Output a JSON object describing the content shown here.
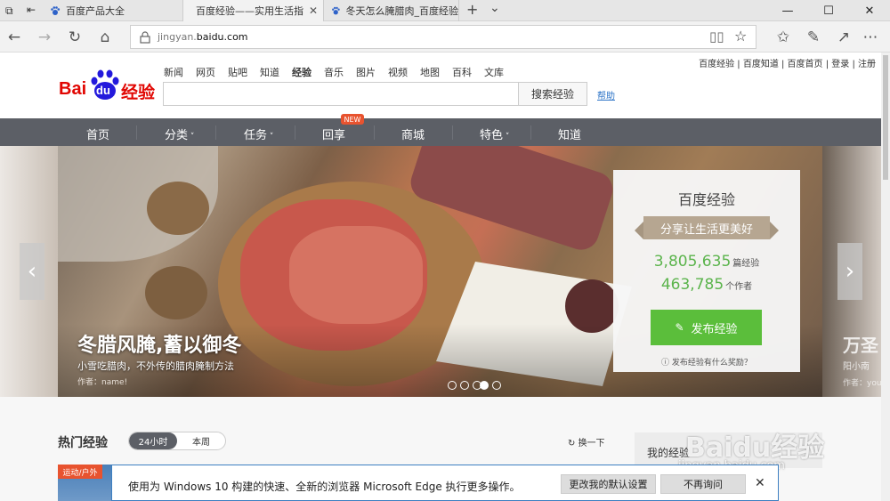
{
  "tabs": [
    {
      "title": "百度产品大全",
      "active": false
    },
    {
      "title": "百度经验——实用生活指",
      "active": true
    },
    {
      "title": "冬天怎么腌腊肉_百度经验",
      "active": false
    }
  ],
  "window_controls": {
    "minimize": "—",
    "maximize": "☐",
    "close": "✕",
    "new_tab": "+",
    "tab_list": "⌄"
  },
  "address": {
    "prefix": "jingyan.",
    "domain": "baidu.com"
  },
  "top_links": "百度经验 | 百度知道 | 百度首页 | 登录 | 注册",
  "logo": {
    "bai": "Bai",
    "du": "du",
    "jingyan": "经验"
  },
  "main_nav": [
    "新闻",
    "网页",
    "贴吧",
    "知道",
    "经验",
    "音乐",
    "图片",
    "视频",
    "地图",
    "百科",
    "文库"
  ],
  "search": {
    "button": "搜索经验",
    "help": "帮助"
  },
  "gray_nav": [
    "首页",
    "分类",
    "任务",
    "回享",
    "商城",
    "特色",
    "知道"
  ],
  "new_badge": "NEW",
  "banner": {
    "title": "冬腊风腌,蓄以御冬",
    "subtitle": "小雪吃腊肉，不外传的腊肉腌制方法",
    "author": "作者：name!",
    "slides_total": 5,
    "slide_active": 4,
    "peek_title": "万圣",
    "peek_sub": "阳小南",
    "peek_author": "作者：you"
  },
  "card": {
    "title": "百度经验",
    "ribbon": "分享让生活更美好",
    "experience_count": "3,805,635",
    "experience_unit": "篇经验",
    "author_count": "463,785",
    "author_unit": "个作者",
    "publish_button": "发布经验",
    "reward_link": "发布经验有什么奖励？"
  },
  "hot": {
    "title": "热门经验",
    "tab_24h": "24小时",
    "tab_week": "本周",
    "refresh": "换一下",
    "my_exp": "我的经验",
    "thumb_tag": "运动/户外"
  },
  "watermark": {
    "logo": "Baidu经验",
    "url": "jingyan.baidu.com"
  },
  "notification": {
    "text": "使用为 Windows 10 构建的快速、全新的浏览器 Microsoft Edge 执行更多操作。",
    "set_default": "更改我的默认设置",
    "dont_ask": "不再询问"
  },
  "colors": {
    "accent_green": "#5bbe3b",
    "nav_gray": "#5c5f66",
    "badge_red": "#e8532f",
    "baidu_red": "#e10602",
    "baidu_blue": "#2319dc"
  }
}
